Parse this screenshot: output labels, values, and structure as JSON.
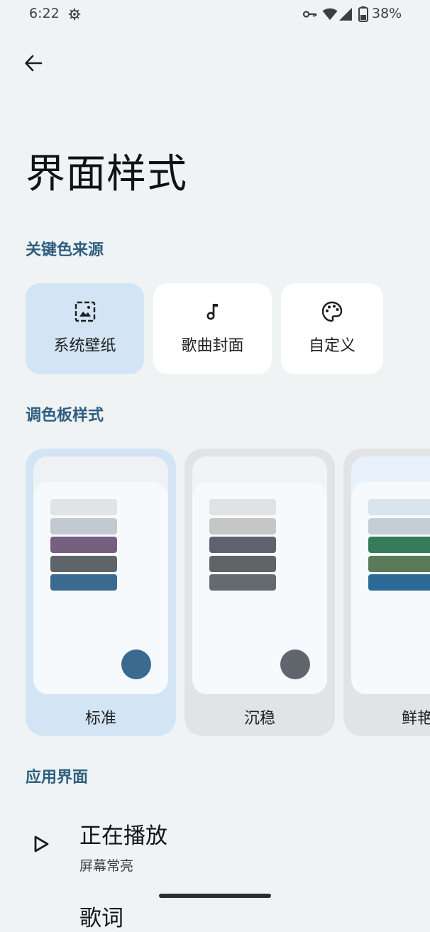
{
  "status_bar": {
    "time": "6:22",
    "battery_percent": "38%",
    "icons": [
      "gear-icon",
      "vpn-key-icon",
      "wifi-icon",
      "cell-signal-icon",
      "battery-icon"
    ]
  },
  "header": {
    "back_icon": "arrow-left-icon",
    "title": "界面样式"
  },
  "key_color_source": {
    "section_title": "关键色来源",
    "options": [
      {
        "label": "系统壁纸",
        "icon": "wallpaper-icon",
        "selected": true
      },
      {
        "label": "歌曲封面",
        "icon": "music-note-icon",
        "selected": false
      },
      {
        "label": "自定义",
        "icon": "palette-icon",
        "selected": false
      }
    ]
  },
  "palette_style": {
    "section_title": "调色板样式",
    "options": [
      {
        "label": "标准",
        "selected": true,
        "swatches": [
          "#e1e3e4",
          "#c3c9d0",
          "#76607f",
          "#5f6469",
          "#3a6a90"
        ],
        "dot_color": "#3a6a90",
        "card_bg": "#d3e4f4",
        "outer_bg": "#eef2f5"
      },
      {
        "label": "沉稳",
        "selected": false,
        "swatches": [
          "#e1e2e3",
          "#c6c6c7",
          "#5f6070",
          "#5f6266",
          "#656a6f"
        ],
        "dot_color": "#60666b",
        "card_bg": "#e1e3e4",
        "outer_bg": "#f2f3f4"
      },
      {
        "label": "鲜艳",
        "selected": false,
        "swatches": [
          "#dae4ee",
          "#c3ced6",
          "#367c5a",
          "#5a7a5a",
          "#2e6a98"
        ],
        "dot_color": "#2e6a98",
        "card_bg": "#e1e3e4",
        "outer_bg": "#e8f2fc"
      }
    ]
  },
  "app_interface": {
    "section_title": "应用界面",
    "items": [
      {
        "title": "正在播放",
        "subtitle": "屏幕常亮",
        "icon": "play-outline-icon"
      }
    ],
    "next_item_title_partial": "歌词"
  }
}
